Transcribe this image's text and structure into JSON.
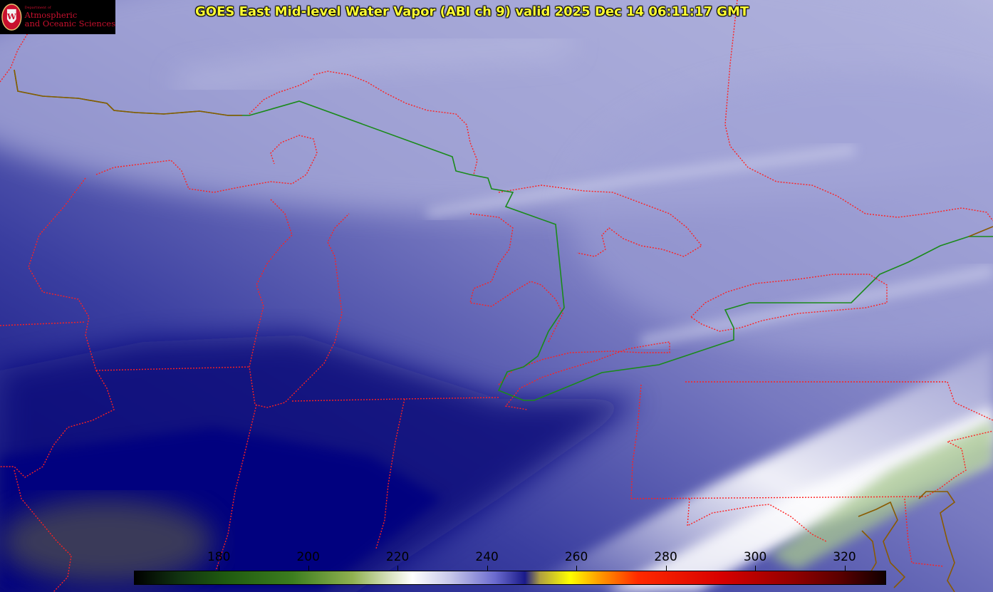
{
  "title": "GOES East Mid-level Water Vapor (ABI ch 9)  valid 2025 Dec 14 06:11:17 GMT",
  "logo": {
    "department": "Department of",
    "line1": "Atmospheric",
    "line2": "and Oceanic Sciences",
    "seal_letter": "W"
  },
  "colorbar": {
    "ticks": [
      {
        "label": "180",
        "value": 180
      },
      {
        "label": "200",
        "value": 200
      },
      {
        "label": "220",
        "value": 220
      },
      {
        "label": "240",
        "value": 240
      },
      {
        "label": "260",
        "value": 260
      },
      {
        "label": "280",
        "value": 280
      },
      {
        "label": "300",
        "value": 300
      },
      {
        "label": "320",
        "value": 320
      }
    ],
    "min": 161,
    "max": 329
  },
  "colors": {
    "title": "#ffff33",
    "state_borders": "#ff2020",
    "international_border": "#1a8a1a",
    "coastline": "#8a5a00"
  }
}
